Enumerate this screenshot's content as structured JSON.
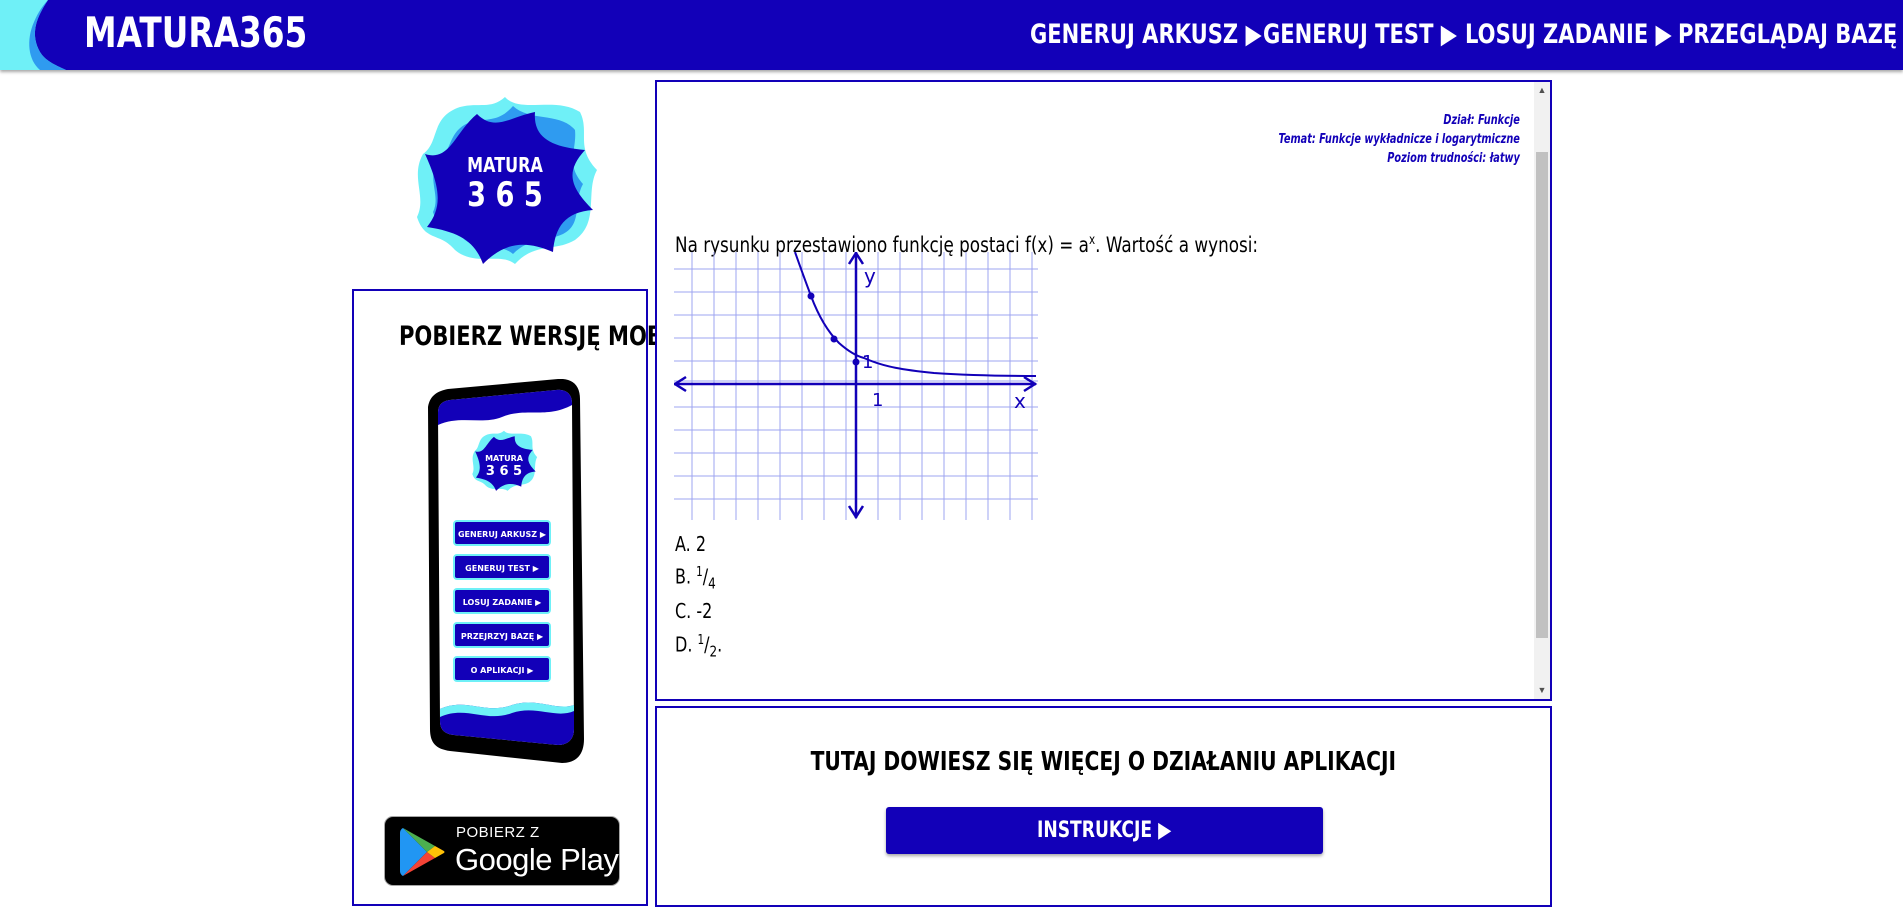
{
  "header": {
    "brand": "MATURA365",
    "nav": [
      {
        "label": "GENERUJ ARKUSZ ▶"
      },
      {
        "label": "GENERUJ TEST ▶"
      },
      {
        "label": "LOSUJ ZADANIE ▶"
      },
      {
        "label": "PRZEGLĄDAJ BAZĘ ▶"
      }
    ]
  },
  "logo": {
    "line1": "MATURA",
    "line2": "3 6 5"
  },
  "mobile": {
    "title": "POBIERZ WERSJĘ MOBILNĄ",
    "phone_logo": {
      "line1": "MATURA",
      "line2": "3 6 5"
    },
    "phone_buttons": [
      "GENERUJ ARKUSZ ▶",
      "GENERUJ TEST ▶",
      "LOSUJ ZADANIE ▶",
      "PRZEJRZYJ BAZĘ ▶",
      "O APLIKACJI ▶"
    ],
    "store_top": "POBIERZ Z",
    "store_main": "Google Play"
  },
  "task": {
    "meta": {
      "dzial": "Dział: Funkcje",
      "temat": "Temat: Funkcje wykładnicze i logarytmiczne",
      "poziom": "Poziom trudności: łatwy"
    },
    "question_pre": "Na rysunku przestawiono funkcję postaci f(x) = a",
    "question_sup": "x",
    "question_post": ". Wartość a wynosi:",
    "graph": {
      "y_label": "y",
      "x_label": "x",
      "one_x": "1",
      "one_y": "1"
    },
    "answers": {
      "a": {
        "prefix": "A. ",
        "text": "2"
      },
      "b": {
        "prefix": "B. ",
        "num": "1",
        "den": "4"
      },
      "c": {
        "prefix": "C. ",
        "text": "-2"
      },
      "d": {
        "prefix": "D. ",
        "num": "1",
        "den": "2",
        "suffix": "."
      }
    }
  },
  "info": {
    "title": "TUTAJ DOWIESZ SIĘ WIĘCEJ O DZIAŁANIU APLIKACJI",
    "button": "INSTRUKCJE ▶"
  },
  "colors": {
    "primary": "#1200b8",
    "accent_light": "#6ff0f7",
    "accent_mid": "#2f9bf0"
  }
}
